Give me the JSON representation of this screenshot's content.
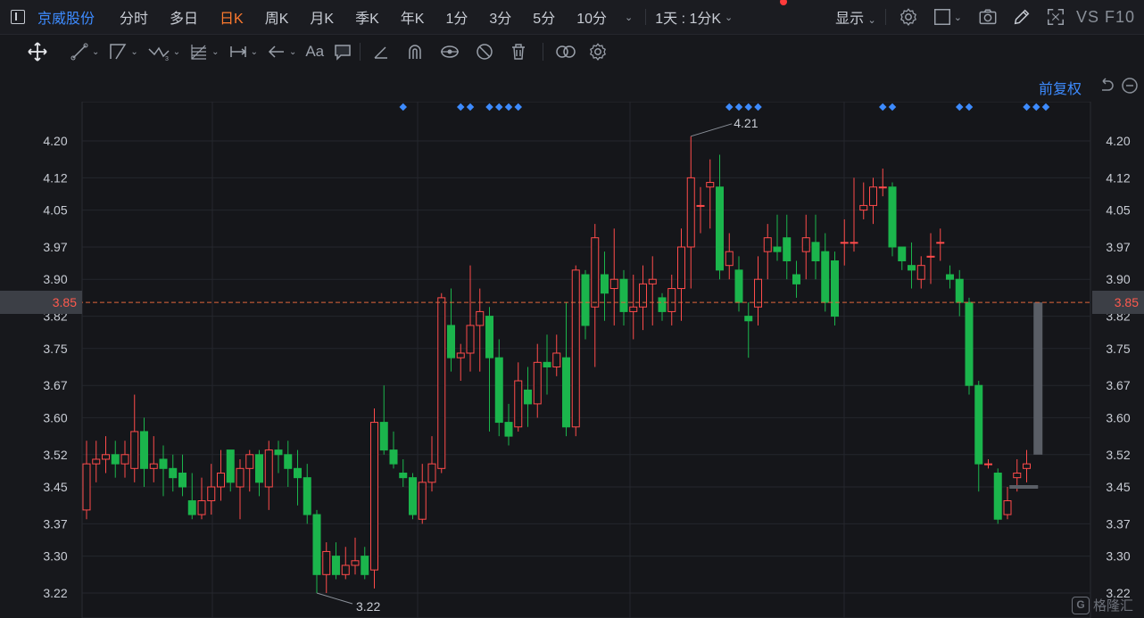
{
  "header": {
    "stock_name": "京威股份",
    "periods": [
      {
        "label": "分时",
        "active": false
      },
      {
        "label": "多日",
        "active": false
      },
      {
        "label": "日K",
        "active": true
      },
      {
        "label": "周K",
        "active": false
      },
      {
        "label": "月K",
        "active": false
      },
      {
        "label": "季K",
        "active": false
      },
      {
        "label": "年K",
        "active": false
      },
      {
        "label": "1分",
        "active": false
      },
      {
        "label": "3分",
        "active": false
      },
      {
        "label": "5分",
        "active": false
      },
      {
        "label": "10分",
        "active": false
      }
    ],
    "interval_label": "1天 : 1分K",
    "display_label": "显示",
    "f10_label": "VS F10"
  },
  "toolbar": {
    "tools": [
      "move-icon",
      "line-icon",
      "polyline-icon",
      "wave-icon",
      "fib-icon",
      "range-icon",
      "arrow-icon",
      "text-icon",
      "comment-icon",
      "pen-icon",
      "magnet-icon",
      "eye-lock-icon",
      "hide-icon",
      "trash-icon",
      "compare-icon",
      "settings-icon"
    ],
    "text_tool": "Aa"
  },
  "chart_top": {
    "adjust_label": "前复权"
  },
  "colors": {
    "up": "#ff4b4b",
    "down": "#1bb54c",
    "accent": "#3d8bff",
    "active": "#ff7a2e",
    "ref_line": "#e0653c"
  },
  "chart_data": {
    "type": "candlestick",
    "y_ticks": [
      "4.20",
      "4.12",
      "4.05",
      "3.97",
      "3.90",
      "3.82",
      "3.75",
      "3.67",
      "3.60",
      "3.52",
      "3.45",
      "3.37",
      "3.30",
      "3.22"
    ],
    "ylim": [
      3.19,
      4.31
    ],
    "current_price": "3.85",
    "high_label": "4.21",
    "low_label": "3.22",
    "candles": [
      [
        3.4,
        3.5,
        3.38,
        3.55
      ],
      [
        3.5,
        3.51,
        3.46,
        3.55
      ],
      [
        3.51,
        3.52,
        3.48,
        3.56
      ],
      [
        3.52,
        3.5,
        3.47,
        3.55
      ],
      [
        3.5,
        3.52,
        3.47,
        3.55
      ],
      [
        3.49,
        3.57,
        3.46,
        3.65
      ],
      [
        3.57,
        3.49,
        3.45,
        3.6
      ],
      [
        3.49,
        3.5,
        3.46,
        3.56
      ],
      [
        3.51,
        3.49,
        3.43,
        3.54
      ],
      [
        3.49,
        3.47,
        3.44,
        3.52
      ],
      [
        3.48,
        3.45,
        3.43,
        3.52
      ],
      [
        3.42,
        3.39,
        3.38,
        3.48
      ],
      [
        3.39,
        3.42,
        3.38,
        3.47
      ],
      [
        3.42,
        3.45,
        3.39,
        3.5
      ],
      [
        3.45,
        3.48,
        3.42,
        3.53
      ],
      [
        3.53,
        3.46,
        3.44,
        3.53
      ],
      [
        3.45,
        3.49,
        3.38,
        3.51
      ],
      [
        3.49,
        3.52,
        3.44,
        3.53
      ],
      [
        3.52,
        3.46,
        3.43,
        3.53
      ],
      [
        3.45,
        3.53,
        3.4,
        3.55
      ],
      [
        3.53,
        3.52,
        3.48,
        3.55
      ],
      [
        3.52,
        3.49,
        3.45,
        3.55
      ],
      [
        3.49,
        3.47,
        3.41,
        3.53
      ],
      [
        3.47,
        3.39,
        3.37,
        3.5
      ],
      [
        3.39,
        3.26,
        3.22,
        3.4
      ],
      [
        3.26,
        3.31,
        3.22,
        3.33
      ],
      [
        3.3,
        3.26,
        3.25,
        3.33
      ],
      [
        3.26,
        3.28,
        3.25,
        3.32
      ],
      [
        3.28,
        3.29,
        3.26,
        3.34
      ],
      [
        3.3,
        3.26,
        3.25,
        3.32
      ],
      [
        3.27,
        3.59,
        3.23,
        3.62
      ],
      [
        3.59,
        3.53,
        3.52,
        3.67
      ],
      [
        3.53,
        3.5,
        3.49,
        3.57
      ],
      [
        3.48,
        3.47,
        3.45,
        3.51
      ],
      [
        3.47,
        3.39,
        3.38,
        3.48
      ],
      [
        3.38,
        3.46,
        3.37,
        3.5
      ],
      [
        3.46,
        3.5,
        3.44,
        3.56
      ],
      [
        3.49,
        3.86,
        3.48,
        3.87
      ],
      [
        3.8,
        3.73,
        3.7,
        3.88
      ],
      [
        3.73,
        3.74,
        3.68,
        3.76
      ],
      [
        3.74,
        3.8,
        3.7,
        3.93
      ],
      [
        3.8,
        3.83,
        3.7,
        3.88
      ],
      [
        3.82,
        3.73,
        3.57,
        3.84
      ],
      [
        3.73,
        3.59,
        3.56,
        3.77
      ],
      [
        3.59,
        3.56,
        3.54,
        3.63
      ],
      [
        3.58,
        3.68,
        3.57,
        3.72
      ],
      [
        3.66,
        3.63,
        3.58,
        3.71
      ],
      [
        3.63,
        3.72,
        3.6,
        3.76
      ],
      [
        3.72,
        3.71,
        3.65,
        3.78
      ],
      [
        3.71,
        3.74,
        3.69,
        3.78
      ],
      [
        3.73,
        3.58,
        3.56,
        3.85
      ],
      [
        3.58,
        3.92,
        3.56,
        3.93
      ],
      [
        3.91,
        3.8,
        3.77,
        3.92
      ],
      [
        3.84,
        3.99,
        3.71,
        4.02
      ],
      [
        3.91,
        3.87,
        3.81,
        3.96
      ],
      [
        3.88,
        3.9,
        3.8,
        4.01
      ],
      [
        3.9,
        3.83,
        3.8,
        3.92
      ],
      [
        3.83,
        3.84,
        3.77,
        3.91
      ],
      [
        3.84,
        3.89,
        3.79,
        3.93
      ],
      [
        3.89,
        3.9,
        3.8,
        3.95
      ],
      [
        3.86,
        3.83,
        3.81,
        3.87
      ],
      [
        3.83,
        3.88,
        3.8,
        3.91
      ],
      [
        3.88,
        3.97,
        3.81,
        4.01
      ],
      [
        3.97,
        4.12,
        3.88,
        4.21
      ],
      [
        4.06,
        4.06,
        4.0,
        4.1
      ],
      [
        4.1,
        4.11,
        4.01,
        4.16
      ],
      [
        4.1,
        3.92,
        3.9,
        4.17
      ],
      [
        3.93,
        3.96,
        3.9,
        4.0
      ],
      [
        3.92,
        3.85,
        3.83,
        3.95
      ],
      [
        3.82,
        3.81,
        3.73,
        3.85
      ],
      [
        3.84,
        3.9,
        3.8,
        3.95
      ],
      [
        3.96,
        3.99,
        3.9,
        4.02
      ],
      [
        3.97,
        3.96,
        3.94,
        4.04
      ],
      [
        3.99,
        3.94,
        3.9,
        4.04
      ],
      [
        3.91,
        3.89,
        3.86,
        3.94
      ],
      [
        3.96,
        3.99,
        3.9,
        4.04
      ],
      [
        3.98,
        3.94,
        3.9,
        4.04
      ],
      [
        3.96,
        3.85,
        3.83,
        4.0
      ],
      [
        3.94,
        3.82,
        3.8,
        3.96
      ],
      [
        3.98,
        3.98,
        3.93,
        4.03
      ],
      [
        3.98,
        3.98,
        3.96,
        4.12
      ],
      [
        4.05,
        4.06,
        4.03,
        4.11
      ],
      [
        4.06,
        4.1,
        4.02,
        4.12
      ],
      [
        4.1,
        4.1,
        4.08,
        4.14
      ],
      [
        4.1,
        3.97,
        3.95,
        4.11
      ],
      [
        3.97,
        3.94,
        3.92,
        3.97
      ],
      [
        3.93,
        3.92,
        3.88,
        3.98
      ],
      [
        3.9,
        3.93,
        3.88,
        3.95
      ],
      [
        3.95,
        3.95,
        3.89,
        4.0
      ],
      [
        3.98,
        3.98,
        3.94,
        4.01
      ],
      [
        3.91,
        3.9,
        3.88,
        3.93
      ],
      [
        3.9,
        3.85,
        3.82,
        3.92
      ],
      [
        3.85,
        3.67,
        3.65,
        3.86
      ],
      [
        3.67,
        3.5,
        3.44,
        3.68
      ],
      [
        3.5,
        3.5,
        3.49,
        3.51
      ],
      [
        3.48,
        3.38,
        3.37,
        3.49
      ],
      [
        3.39,
        3.42,
        3.38,
        3.45
      ],
      [
        3.47,
        3.48,
        3.44,
        3.51
      ],
      [
        3.49,
        3.5,
        3.46,
        3.53
      ]
    ],
    "event_markers": [
      33,
      39,
      40,
      42,
      43,
      44,
      45,
      67,
      68,
      69,
      70,
      83,
      84,
      91,
      92,
      98,
      99,
      100
    ],
    "live_bar": {
      "top": 3.85,
      "bottom": 3.52,
      "base": 3.45
    }
  }
}
